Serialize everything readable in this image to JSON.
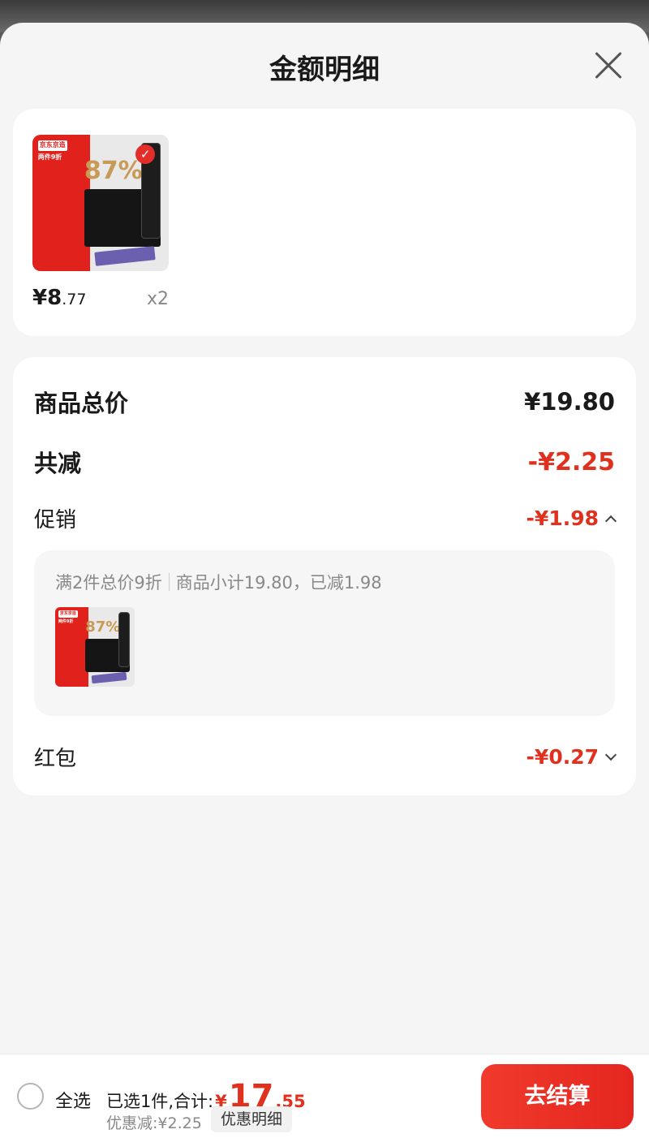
{
  "sheet": {
    "title": "金额明细"
  },
  "product": {
    "badge_brand": "京东京造",
    "badge_promo": "两件9折",
    "badge_percent": "87%",
    "price_symbol": "¥",
    "price_int": "8",
    "price_dec": ".77",
    "quantity": "x2"
  },
  "summary": {
    "total_label": "商品总价",
    "total_value": "¥19.80",
    "discount_label": "共减",
    "discount_value": "-¥2.25",
    "promo_label": "促销",
    "promo_value": "-¥1.98",
    "promo_rule": "满2件总价9折",
    "promo_detail": "商品小计19.80，已减1.98",
    "hongbao_label": "红包",
    "hongbao_value": "-¥0.27"
  },
  "bottom": {
    "select_all": "全选",
    "selected_text": "已选1件,合计:",
    "currency": "¥",
    "total_int": "17",
    "total_dec": ".55",
    "saved_text": "优惠减:¥2.25",
    "detail_button": "优惠明细",
    "checkout_button": "去结算"
  },
  "icons": {
    "close": "close-icon",
    "expand_up": "chevron-up-icon",
    "expand_down": "chevron-down-icon",
    "checkbox": "radio-unchecked-icon",
    "selected": "check-circle-icon"
  },
  "colors": {
    "accent": "#e0311f",
    "background": "#f5f5f5",
    "card": "#ffffff"
  }
}
